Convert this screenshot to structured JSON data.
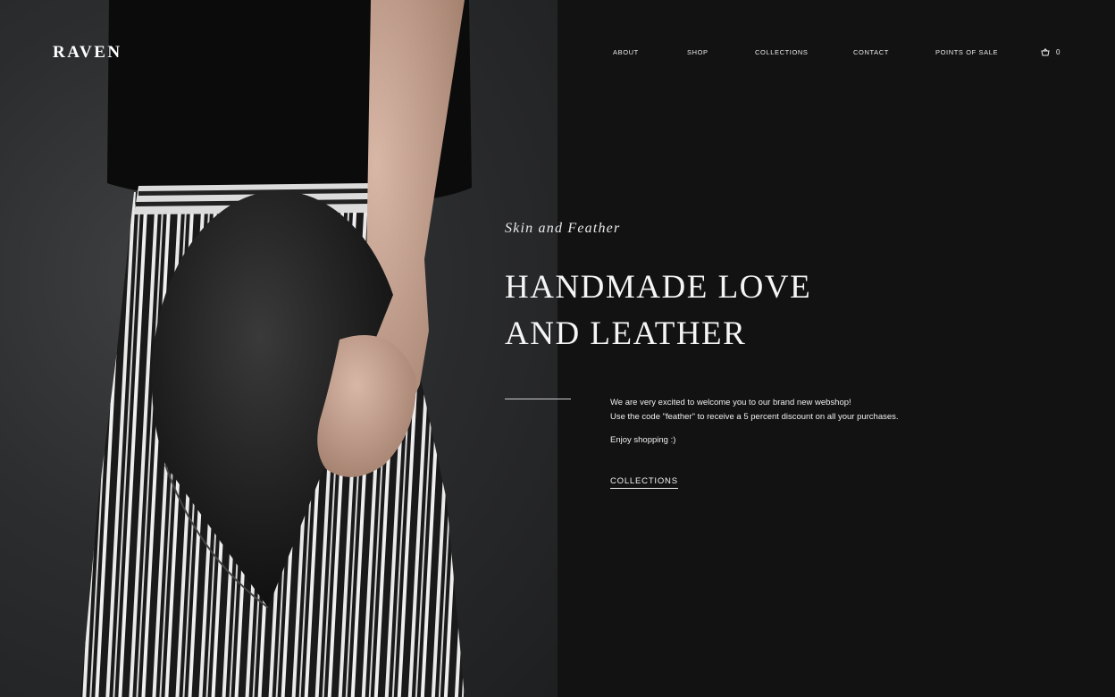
{
  "brand": {
    "logo": "RAVEN"
  },
  "nav": {
    "items": [
      {
        "label": "ABOUT"
      },
      {
        "label": "SHOP"
      },
      {
        "label": "COLLECTIONS"
      },
      {
        "label": "CONTACT"
      },
      {
        "label": "POINTS OF SALE"
      }
    ],
    "cart_count": "0",
    "cart_icon": "basket-icon"
  },
  "hero": {
    "image": "model-with-leather-clutch-photo",
    "subtitle": "Skin and Feather",
    "headline_line1": "HANDMADE LOVE",
    "headline_line2": "AND LEATHER",
    "intro_line1": "We are very excited to welcome you to our brand new webshop!",
    "intro_line2": "Use the code \"feather\" to receive a 5 percent discount on all your purchases.",
    "intro_line3": "Enjoy shopping :)",
    "cta_label": "COLLECTIONS"
  },
  "colors": {
    "background": "#121212",
    "text": "#f2f2f2",
    "photo_bg": "#2c2d2f"
  }
}
